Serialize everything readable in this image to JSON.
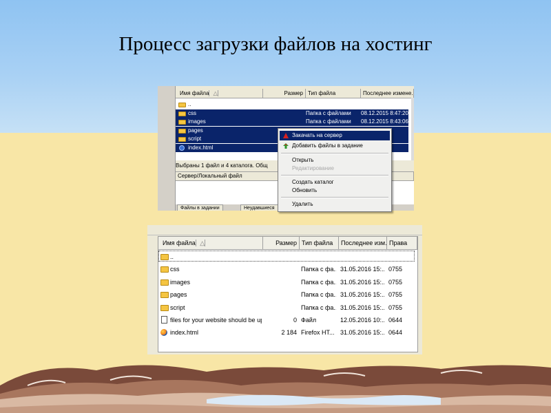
{
  "slide": {
    "title": "Процесс загрузки файлов на хостинг"
  },
  "colors": {
    "selection": "#0a246a",
    "sky": "#a9d1f4",
    "sand": "#f8e6a6",
    "folder": "#f5c542"
  },
  "window1": {
    "columns": [
      "Имя файла",
      "Размер",
      "Тип файла",
      "Последнее измене..."
    ],
    "rows": [
      {
        "name": "..",
        "size": "",
        "type": "",
        "date": "",
        "icon": "folder-icon",
        "selected": false
      },
      {
        "name": "css",
        "size": "",
        "type": "Папка с файлами",
        "date": "08.12.2015 8:47:20",
        "icon": "folder-icon",
        "selected": true
      },
      {
        "name": "images",
        "size": "",
        "type": "Папка с файлами",
        "date": "08.12.2015 8:43:06",
        "icon": "folder-icon",
        "selected": true
      },
      {
        "name": "pages",
        "size": "",
        "type": "",
        "date": "06",
        "icon": "folder-icon",
        "selected": true
      },
      {
        "name": "script",
        "size": "",
        "type": "",
        "date": "06",
        "icon": "folder-icon",
        "selected": true
      },
      {
        "name": "index.html",
        "size": "2 2",
        "type": "",
        "date": "56",
        "icon": "html-file-icon",
        "selected": true
      }
    ],
    "status": "Выбраны 1 файл и 4 каталога. Общ",
    "queue_columns": [
      "Сервер/Локальный файл"
    ],
    "tabs": [
      "Файлы в задании",
      "Неудавшиеся"
    ]
  },
  "context_menu": {
    "items": [
      {
        "label": "Закачать на сервер",
        "highlighted": true,
        "disabled": false,
        "icon": "upload-arrow-icon"
      },
      {
        "label": "Добавить файлы в задание",
        "highlighted": false,
        "disabled": false,
        "icon": "add-queue-icon"
      },
      {
        "label": "Открыть",
        "highlighted": false,
        "disabled": false
      },
      {
        "label": "Редактирование",
        "highlighted": false,
        "disabled": true
      },
      {
        "label": "Создать каталог",
        "highlighted": false,
        "disabled": false
      },
      {
        "label": "Обновить",
        "highlighted": false,
        "disabled": false
      },
      {
        "label": "Удалить",
        "highlighted": false,
        "disabled": false
      }
    ]
  },
  "window2": {
    "columns": [
      "Имя файла",
      "Размер",
      "Тип файла",
      "Последнее изм...",
      "Права"
    ],
    "rows": [
      {
        "name": "..",
        "size": "",
        "type": "",
        "date": "",
        "perm": "",
        "icon": "folder-icon"
      },
      {
        "name": "css",
        "size": "",
        "type": "Папка с фа...",
        "date": "31.05.2016 15:...",
        "perm": "0755",
        "icon": "folder-icon"
      },
      {
        "name": "images",
        "size": "",
        "type": "Папка с фа...",
        "date": "31.05.2016 15:...",
        "perm": "0755",
        "icon": "folder-icon"
      },
      {
        "name": "pages",
        "size": "",
        "type": "Папка с фа...",
        "date": "31.05.2016 15:...",
        "perm": "0755",
        "icon": "folder-icon"
      },
      {
        "name": "script",
        "size": "",
        "type": "Папка с фа...",
        "date": "31.05.2016 15:...",
        "perm": "0755",
        "icon": "folder-icon"
      },
      {
        "name": "files for your website should be uplo...",
        "size": "0",
        "type": "Файл",
        "date": "12.05.2016 10:...",
        "perm": "0644",
        "icon": "text-file-icon"
      },
      {
        "name": "index.html",
        "size": "2 184",
        "type": "Firefox HT...",
        "date": "31.05.2016 15:...",
        "perm": "0644",
        "icon": "firefox-html-icon"
      }
    ]
  }
}
